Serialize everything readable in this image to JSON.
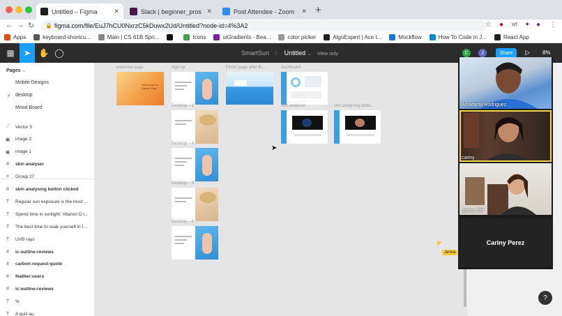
{
  "browser": {
    "tabs": [
      {
        "title": "Untitled – Figma",
        "icon_color": "#1e1e1e",
        "active": true
      },
      {
        "title": "Slack | beginner_pros | Girls in...",
        "icon_color": "#4a154b",
        "active": false
      },
      {
        "title": "Post Attendee - Zoom",
        "icon_color": "#2d8cff",
        "active": false
      }
    ],
    "new_tab_label": "+",
    "url": "figma.com/file/EuJ7hCU0NxrzC5kDuwx2Ud/Untitled?node-id=4%3A2",
    "bookmarks": [
      {
        "label": "Apps",
        "color": "#e64a19"
      },
      {
        "label": "keyboard-shortcu...",
        "color": "#555555"
      },
      {
        "label": "Main | CS 61B Spri...",
        "color": "#888888"
      },
      {
        "label": "",
        "color": "#111111"
      },
      {
        "label": "Icons",
        "color": "#45a049"
      },
      {
        "label": "uiGradients - Bea...",
        "color": "#7b1fa2"
      },
      {
        "label": "color picker",
        "color": "#999999"
      },
      {
        "label": "AlgoExpert | Ace t...",
        "color": "#222222"
      },
      {
        "label": "Mockflow",
        "color": "#1976d2"
      },
      {
        "label": "How To Code in J...",
        "color": "#0288d1"
      },
      {
        "label": "React App",
        "color": "#222222"
      }
    ]
  },
  "figma": {
    "project": "SmartSun",
    "file": "Untitled",
    "view_only": "View only",
    "share_label": "Share",
    "zoom_level": "8%",
    "avatars": [
      {
        "initial": "C",
        "color": "#28a745"
      },
      {
        "initial": "J",
        "color": "#5c6bc0"
      }
    ],
    "pages_heading": "Pages",
    "pages": [
      {
        "label": "Mobile Designs",
        "current": false
      },
      {
        "label": "desktop",
        "current": true
      },
      {
        "label": "Mood Board",
        "current": false
      }
    ],
    "layers": [
      {
        "icon": "vector",
        "label": "Vector 3",
        "bold": false
      },
      {
        "icon": "image",
        "label": "image 2",
        "bold": false
      },
      {
        "icon": "image",
        "label": "image 1",
        "bold": false
      },
      {
        "icon": "frame",
        "label": "skin analyser",
        "bold": true
      },
      {
        "icon": "group",
        "label": "Group 27",
        "bold": false
      },
      {
        "icon": "frame",
        "label": "skin analysing button clicked",
        "bold": true
      },
      {
        "icon": "text",
        "label": "Regular sun exposure is the most ...",
        "bold": false
      },
      {
        "icon": "text",
        "label": "Spend time in sunlight. Vitamin D i...",
        "bold": false
      },
      {
        "icon": "text",
        "label": "The best time to soak yourself in t...",
        "bold": false
      },
      {
        "icon": "text",
        "label": "UVB rays",
        "bold": false
      },
      {
        "icon": "frame",
        "label": "ic:outline-reviews",
        "bold": true
      },
      {
        "icon": "frame",
        "label": "carbon:request-quote",
        "bold": true
      },
      {
        "icon": "frame",
        "label": "feather:users",
        "bold": true
      },
      {
        "icon": "frame",
        "label": "ic:outline-reviews",
        "bold": true
      },
      {
        "icon": "text",
        "label": "%",
        "bold": false
      },
      {
        "icon": "text",
        "label": "A quiz au",
        "bold": false
      }
    ],
    "frames": [
      {
        "label": "welcome page",
        "style": "orange"
      },
      {
        "label": "sign up",
        "style": "photo-blue"
      },
      {
        "label": "Finish page after th...",
        "style": "sky"
      },
      {
        "label": "dashboard",
        "style": "dashboard"
      },
      {
        "label": "Desktop – 3",
        "style": "photo-hat"
      },
      {
        "label": "skin analyser",
        "style": "analyser"
      },
      {
        "label": "skin analysing butto...",
        "style": "analyser2"
      },
      {
        "label": "Desktop – 4",
        "style": "photo-blue"
      },
      {
        "label": "Desktop – 5",
        "style": "photo-hat"
      },
      {
        "label": "Desktop – 6",
        "style": "photo-blue"
      }
    ],
    "welcome_text": "Welcome to\nSmart Sun",
    "cursor_tag": "Jenna"
  },
  "zoom": {
    "participants": [
      {
        "name": "Amaranta Rodriguez",
        "speaking": false
      },
      {
        "name": "cariny",
        "speaking": true
      },
      {
        "name": "Jenna Toff",
        "speaking": false
      }
    ],
    "self_name": "Cariny Perez"
  },
  "help_label": "?"
}
